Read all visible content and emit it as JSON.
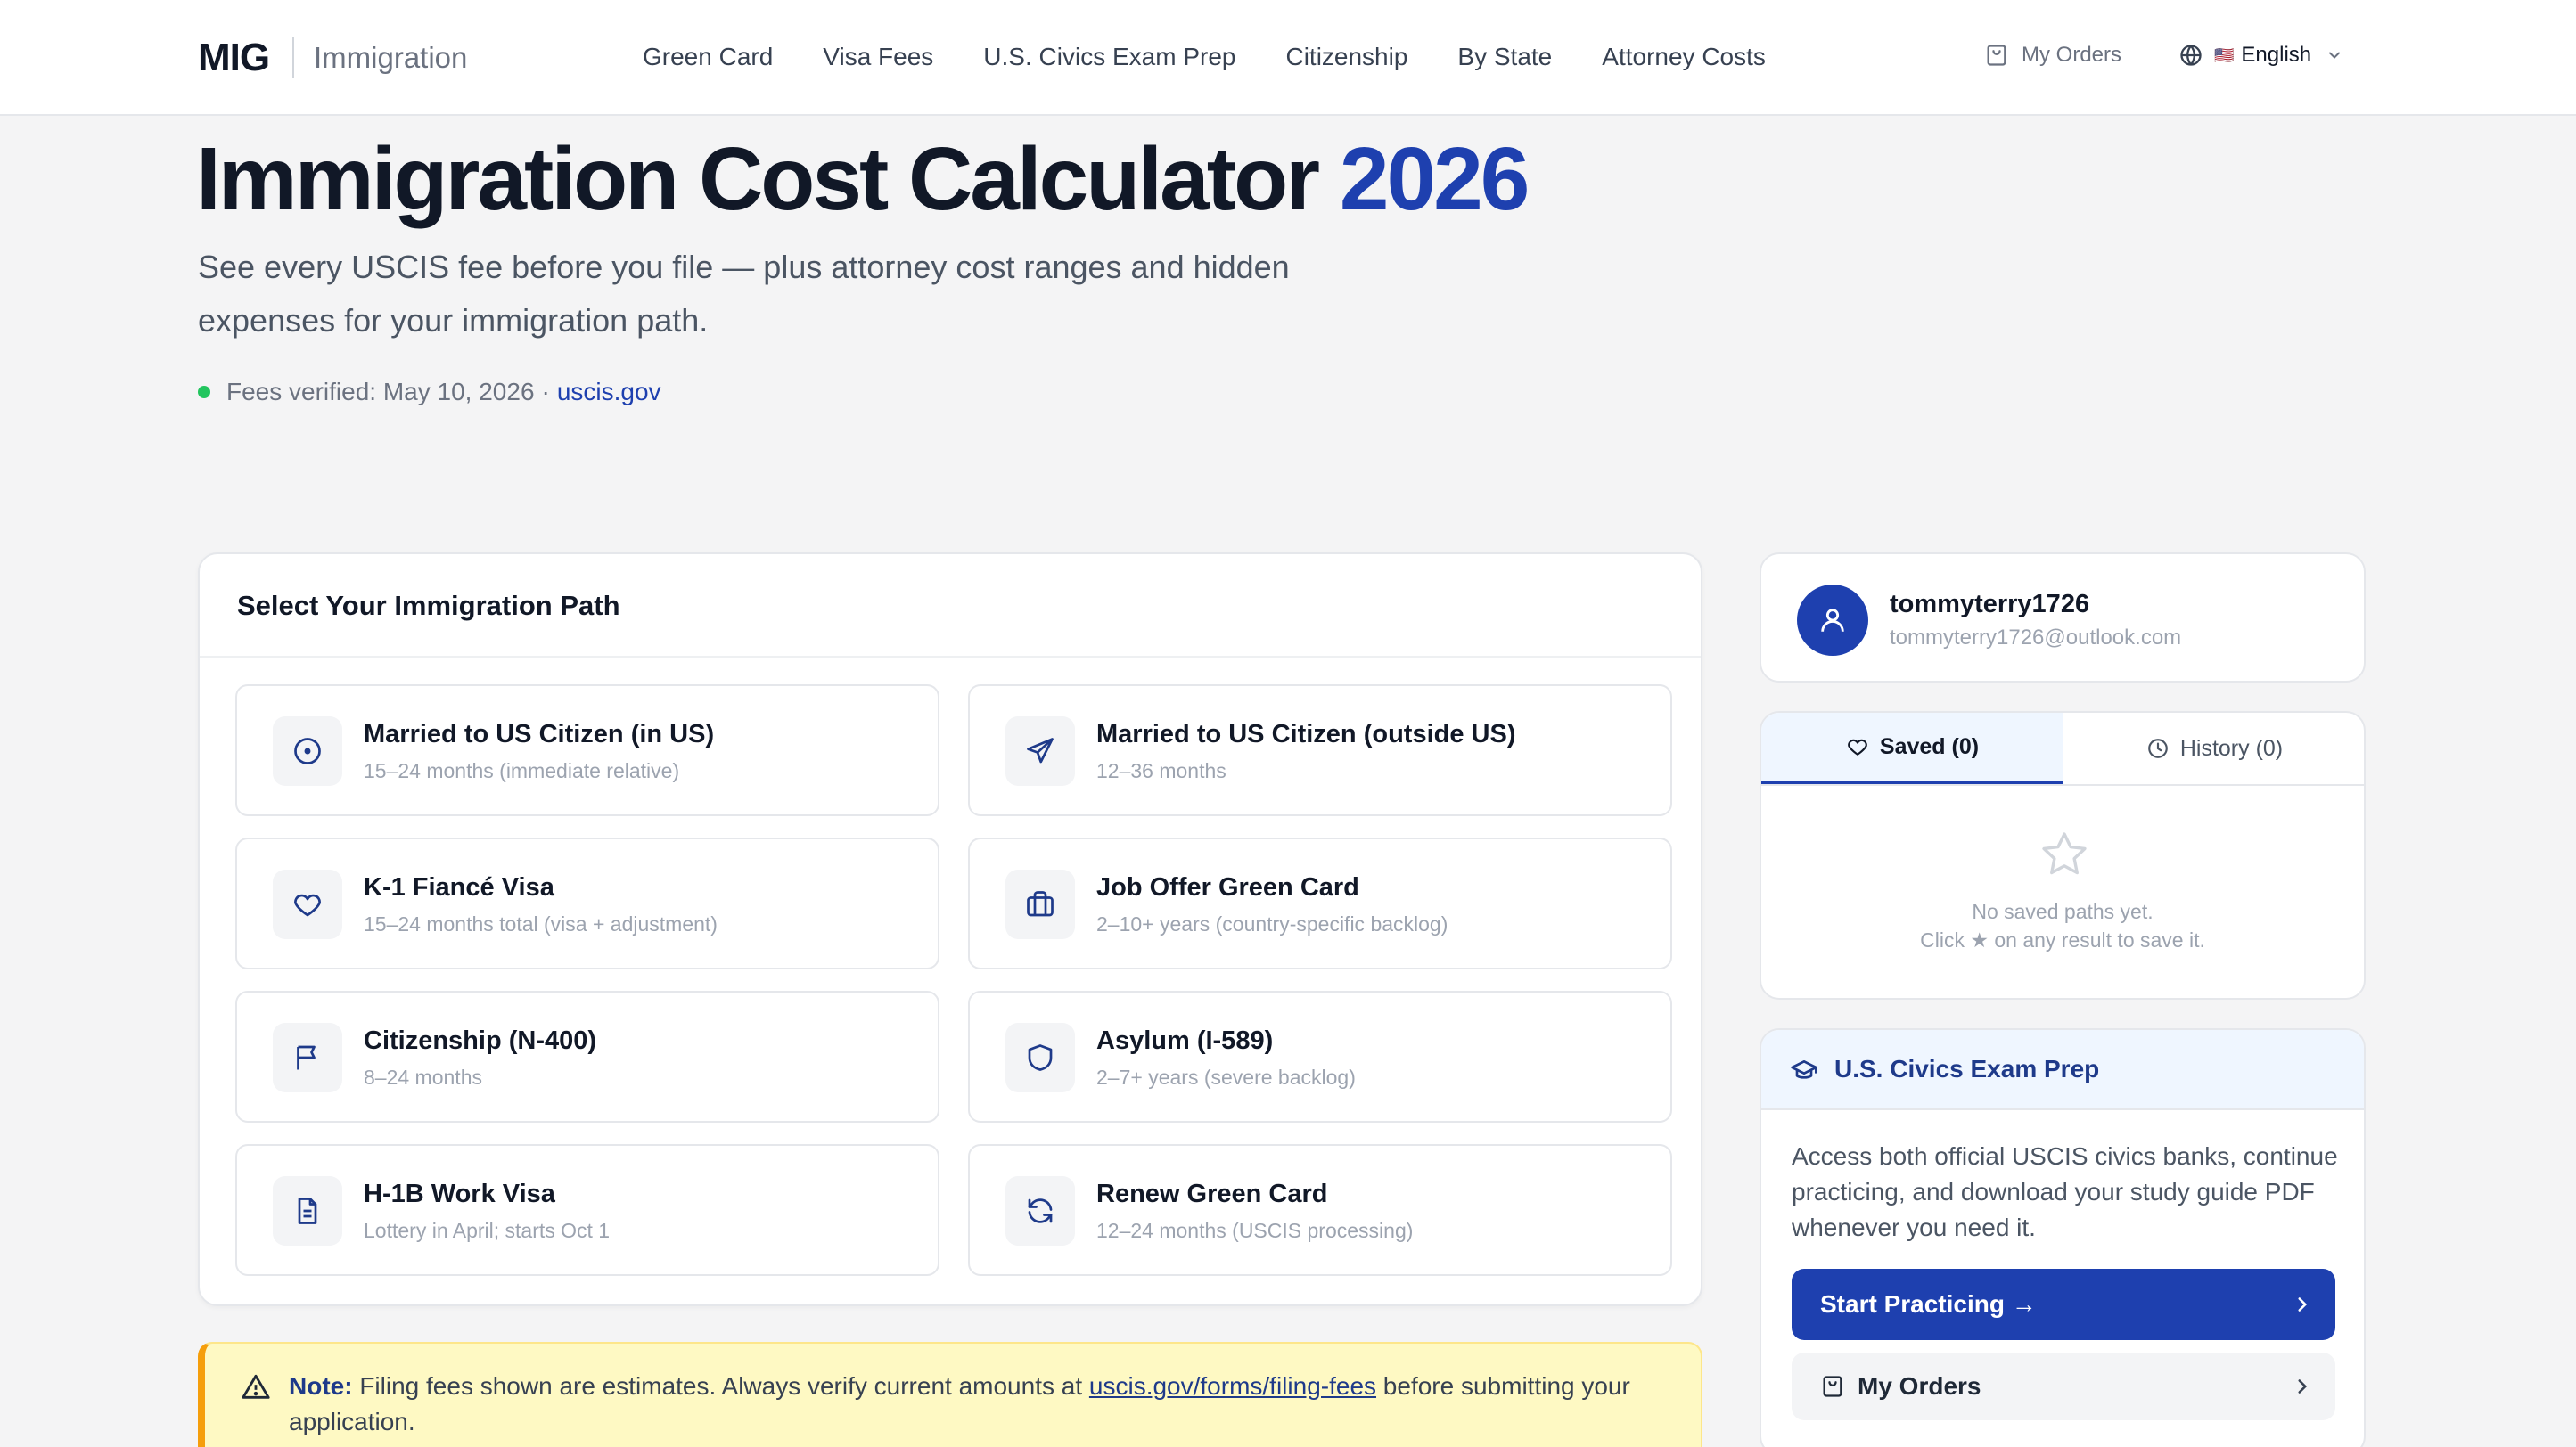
{
  "header": {
    "logo_mark": "MIG",
    "logo_text": "Immigration",
    "nav": [
      "Green Card",
      "Visa Fees",
      "U.S. Civics Exam Prep",
      "Citizenship",
      "By State",
      "Attorney Costs"
    ],
    "my_orders": "My Orders",
    "language": "English",
    "flag": "🇺🇸"
  },
  "hero": {
    "title": "Immigration Cost Calculator",
    "year": "2026",
    "subtitle": "See every USCIS fee before you file — plus attorney cost ranges and hidden expenses for your immigration path.",
    "verified_label": "Fees verified: May 10, 2026",
    "separator": "·",
    "source_link": "uscis.gov",
    "status_color": "#22c55e"
  },
  "paths": {
    "title": "Select Your Immigration Path",
    "items": [
      {
        "title": "Married to US Citizen (in US)",
        "subtitle": "15–24 months (immediate relative)",
        "icon": "target-icon"
      },
      {
        "title": "Married to US Citizen (outside US)",
        "subtitle": "12–36 months",
        "icon": "plane-icon"
      },
      {
        "title": "K-1 Fiancé Visa",
        "subtitle": "15–24 months total (visa + adjustment)",
        "icon": "heart-icon"
      },
      {
        "title": "Job Offer Green Card",
        "subtitle": "2–10+ years (country-specific backlog)",
        "icon": "briefcase-icon"
      },
      {
        "title": "Citizenship (N-400)",
        "subtitle": "8–24 months",
        "icon": "flag-icon"
      },
      {
        "title": "Asylum (I-589)",
        "subtitle": "2–7+ years (severe backlog)",
        "icon": "shield-icon"
      },
      {
        "title": "H-1B Work Visa",
        "subtitle": "Lottery in April; starts Oct 1",
        "icon": "document-icon"
      },
      {
        "title": "Renew Green Card",
        "subtitle": "12–24 months (USCIS processing)",
        "icon": "refresh-icon"
      }
    ]
  },
  "note": {
    "label": "Note:",
    "text_before": "Filing fees shown are estimates. Always verify current amounts at",
    "link": "uscis.gov/forms/filing-fees",
    "text_after": "before submitting your application."
  },
  "user": {
    "name": "tommyterry1726",
    "email": "tommyterry1726@outlook.com"
  },
  "tabs": {
    "saved": "Saved (0)",
    "history": "History (0)",
    "empty_line1": "No saved paths yet.",
    "empty_line2": "Click ★ on any result to save it."
  },
  "civics": {
    "title": "U.S. Civics Exam Prep",
    "body": "Access both official USCIS civics banks, continue practicing, and download your study guide PDF whenever you need it.",
    "start_button": "Start Practicing →",
    "orders_button": "My Orders"
  },
  "colors": {
    "brand": "#1e40af",
    "note_bg": "#fef9c3",
    "note_accent": "#f59e0b"
  }
}
